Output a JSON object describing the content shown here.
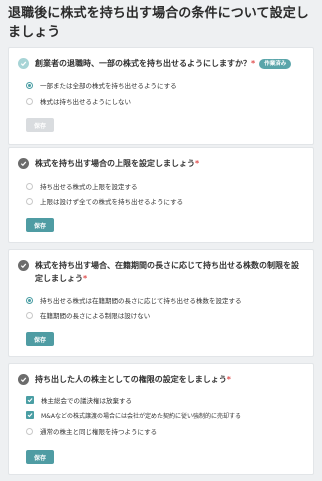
{
  "page_title": "退職後に株式を持ち出す場合の条件について設定しましょう",
  "required_mark": "*",
  "sections": [
    {
      "question": "創業者の退職時、一部の株式を持ち出せるようにしますか？",
      "status_badge": "作業済み",
      "options": [
        {
          "label": "一部または全部の株式を持ち出せるようにする",
          "checked": true
        },
        {
          "label": "株式は持ち出せるようにしない",
          "checked": false
        }
      ],
      "save_label": "保存"
    },
    {
      "question": "株式を持ち出す場合の上限を設定しましょう",
      "options": [
        {
          "label": "持ち出せる株式の上限を設定する",
          "checked": false
        },
        {
          "label": "上限は設けず全ての株式を持ち出せるようにする",
          "checked": false
        }
      ],
      "save_label": "保存"
    },
    {
      "question_line1": "株式を持ち出す場合、在籍期間の長さに応じて持ち出せる株数の制限を設",
      "question_line2": "定しましょう",
      "options": [
        {
          "label": "持ち出せる株式は在籍期間の長さに応じて持ち出せる株数を設定する",
          "checked": true
        },
        {
          "label": "在籍期間の長さによる制限は設けない",
          "checked": false
        }
      ],
      "save_label": "保存"
    },
    {
      "question": "持ち出した人の株主としての権限の設定をしましょう",
      "options": [
        {
          "label": "株主総会での議決権は放棄する",
          "checked": true
        },
        {
          "label": "M&Aなどの株式譲渡の場合には会社が定めた契約に従い強制的に売却する",
          "checked": true
        },
        {
          "label": "通常の株主と同じ権限を持つようにする",
          "checked": false
        }
      ],
      "save_label": "保存"
    }
  ]
}
